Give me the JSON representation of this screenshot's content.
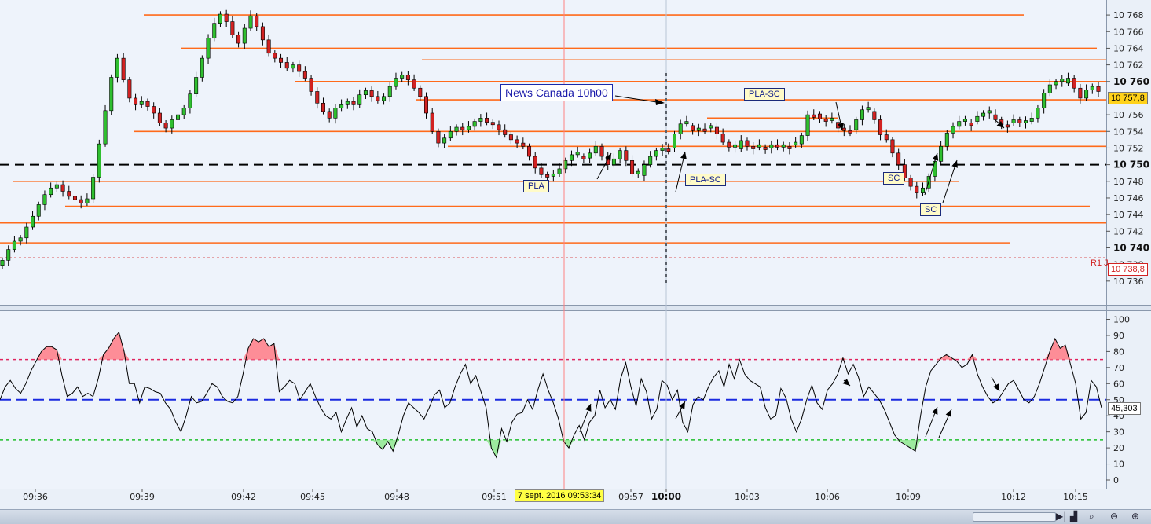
{
  "chart_data": [
    {
      "type": "candlestick",
      "title": "",
      "ylim": [
        10734.5,
        10769
      ],
      "yticks": [
        {
          "v": 10768,
          "t": "10 768",
          "bold": false
        },
        {
          "v": 10766,
          "t": "10 766",
          "bold": false
        },
        {
          "v": 10764,
          "t": "10 764",
          "bold": false
        },
        {
          "v": 10762,
          "t": "10 762",
          "bold": false
        },
        {
          "v": 10760,
          "t": "10 760",
          "bold": true
        },
        {
          "v": 10756,
          "t": "10 756",
          "bold": false
        },
        {
          "v": 10754,
          "t": "10 754",
          "bold": false
        },
        {
          "v": 10752,
          "t": "10 752",
          "bold": false
        },
        {
          "v": 10750,
          "t": "10 750",
          "bold": true
        },
        {
          "v": 10748,
          "t": "10 748",
          "bold": false
        },
        {
          "v": 10746,
          "t": "10 746",
          "bold": false
        },
        {
          "v": 10744,
          "t": "10 744",
          "bold": false
        },
        {
          "v": 10742,
          "t": "10 742",
          "bold": false
        },
        {
          "v": 10740,
          "t": "10 740",
          "bold": true
        },
        {
          "v": 10738,
          "t": "10 738",
          "bold": false
        },
        {
          "v": 10736,
          "t": "10 736",
          "bold": false
        }
      ],
      "xticks": [
        {
          "t": "09:36",
          "bold": false
        },
        {
          "t": "09:39",
          "bold": false
        },
        {
          "t": "09:42",
          "bold": false
        },
        {
          "t": "09:45",
          "bold": false
        },
        {
          "t": "09:48",
          "bold": false
        },
        {
          "t": "09:51",
          "bold": false
        },
        {
          "t": "09:57",
          "bold": false
        },
        {
          "t": "10:00",
          "bold": true
        },
        {
          "t": "10:03",
          "bold": false
        },
        {
          "t": "10:06",
          "bold": false
        },
        {
          "t": "10:09",
          "bold": false
        },
        {
          "t": "10:12",
          "bold": false
        },
        {
          "t": "10:15",
          "bold": false
        }
      ],
      "close_series": [
        10738.5,
        10739.8,
        10740.8,
        10741.2,
        10742.5,
        10743.8,
        10745.2,
        10746.4,
        10747.2,
        10747.6,
        10746.8,
        10746.2,
        10745.8,
        10745.4,
        10745.9,
        10748.5,
        10752.5,
        10756.5,
        10760.5,
        10762.8,
        10760.2,
        10758.0,
        10757.2,
        10757.6,
        10757.0,
        10756.2,
        10755.0,
        10754.4,
        10755.4,
        10756.0,
        10756.8,
        10758.5,
        10760.5,
        10762.8,
        10765.2,
        10767.0,
        10768.1,
        10767.2,
        10765.6,
        10764.6,
        10766.4,
        10767.9,
        10766.6,
        10765.0,
        10763.4,
        10762.8,
        10762.3,
        10761.6,
        10762.0,
        10761.2,
        10760.4,
        10758.8,
        10757.4,
        10756.4,
        10755.6,
        10756.8,
        10757.2,
        10757.6,
        10757.2,
        10758.4,
        10758.9,
        10758.2,
        10757.7,
        10758.2,
        10759.4,
        10760.4,
        10760.8,
        10760.2,
        10759.2,
        10758.2,
        10756.2,
        10754.0,
        10752.6,
        10753.2,
        10754.0,
        10754.5,
        10754.2,
        10754.6,
        10755.2,
        10755.6,
        10755.1,
        10754.8,
        10754.2,
        10753.6,
        10753.0,
        10752.6,
        10752.2,
        10751.0,
        10749.6,
        10748.8,
        10748.6,
        10748.9,
        10749.5,
        10750.5,
        10751.2,
        10751.0,
        10750.8,
        10751.4,
        10752.2,
        10751.0,
        10750.0,
        10750.7,
        10751.7,
        10750.5,
        10748.9,
        10748.7,
        10750.0,
        10751.0,
        10751.7,
        10751.9,
        10752.0,
        10753.7,
        10754.9,
        10754.7,
        10754.1,
        10754.3,
        10754.4,
        10754.5,
        10753.7,
        10752.7,
        10752.1,
        10751.9,
        10752.9,
        10752.2,
        10752.1,
        10752.1,
        10752.0,
        10752.4,
        10752.1,
        10752.2,
        10752.4,
        10752.5,
        10753.5,
        10756.0,
        10756.1,
        10755.5,
        10755.3,
        10755.1,
        10754.4,
        10754.1,
        10754.2,
        10755.4,
        10756.6,
        10756.4,
        10755.4,
        10753.6,
        10753.0,
        10751.4,
        10750.0,
        10748.4,
        10747.4,
        10746.6,
        10747.2,
        10748.6,
        10750.4,
        10752.2,
        10753.8,
        10754.6,
        10755.2,
        10755.0,
        10755.2,
        10755.8,
        10756.2,
        10756.0,
        10755.4,
        10754.8,
        10755.0,
        10755.4,
        10755.0,
        10755.2,
        10755.6,
        10756.8,
        10758.6,
        10759.6,
        10760.0,
        10759.8,
        10760.4,
        10759.2,
        10758.0,
        10759.0,
        10759.4,
        10758.8
      ],
      "horizontal_levels": [
        10768.0,
        10764.0,
        10762.6,
        10760.0,
        10757.8,
        10755.6,
        10754.0,
        10752.2,
        10748.0,
        10745.0,
        10743.0,
        10740.6
      ],
      "dashed_level": 10750,
      "r1_level": 10738.8,
      "r1_label": "R1 J",
      "r1_value_label": "10 738,8",
      "last_price_label": "10 757,8",
      "annotations": [
        {
          "t": "News Canada 10h00",
          "kind": "news"
        },
        {
          "t": "PLA-SC",
          "kind": "tag"
        },
        {
          "t": "PLA",
          "kind": "tag"
        },
        {
          "t": "PLA-SC",
          "kind": "tag"
        },
        {
          "t": "SC",
          "kind": "tag"
        },
        {
          "t": "SC",
          "kind": "tag"
        }
      ],
      "crosshair_date_label": "7 sept. 2016 09:53:34",
      "colors": {
        "up": "#2fbf2f",
        "down": "#d22222",
        "level": "#ff6a1a",
        "plot_bg": "#eef3fb"
      }
    },
    {
      "type": "line",
      "title": "",
      "ylim": [
        -3,
        104
      ],
      "yticks": [
        {
          "v": 100,
          "t": "100"
        },
        {
          "v": 90,
          "t": "90"
        },
        {
          "v": 80,
          "t": "80"
        },
        {
          "v": 70,
          "t": "70"
        },
        {
          "v": 60,
          "t": "60"
        },
        {
          "v": 50,
          "t": "50"
        },
        {
          "v": 40,
          "t": "40"
        },
        {
          "v": 30,
          "t": "30"
        },
        {
          "v": 20,
          "t": "20"
        },
        {
          "v": 10,
          "t": "10"
        },
        {
          "v": 0,
          "t": "0"
        }
      ],
      "levels": {
        "overbought": 75,
        "mid": 50,
        "oversold": 25
      },
      "last_value_label": "45,303",
      "series": [
        50,
        58,
        62,
        57,
        54,
        60,
        68,
        74,
        80,
        83,
        83,
        81,
        65,
        52,
        54,
        58,
        52,
        54,
        52,
        63,
        78,
        82,
        88,
        92,
        80,
        60,
        60,
        48,
        58,
        57,
        55,
        54,
        48,
        44,
        36,
        30,
        40,
        52,
        48,
        49,
        54,
        60,
        58,
        52,
        49,
        48,
        52,
        66,
        82,
        88,
        86,
        88,
        83,
        85,
        55,
        58,
        62,
        60,
        50,
        55,
        60,
        52,
        45,
        40,
        38,
        42,
        30,
        38,
        45,
        33,
        40,
        32,
        30,
        22,
        19,
        24,
        18,
        28,
        40,
        48,
        45,
        42,
        38,
        45,
        53,
        56,
        45,
        48,
        58,
        66,
        72,
        60,
        65,
        55,
        45,
        20,
        14,
        32,
        24,
        36,
        41,
        42,
        50,
        44,
        56,
        66,
        56,
        48,
        38,
        24,
        20,
        28,
        34,
        25,
        36,
        40,
        56,
        45,
        50,
        44,
        63,
        73,
        58,
        46,
        63,
        55,
        38,
        44,
        62,
        59,
        50,
        56,
        36,
        30,
        47,
        52,
        50,
        58,
        64,
        68,
        58,
        72,
        63,
        75,
        66,
        62,
        60,
        58,
        45,
        38,
        40,
        57,
        51,
        38,
        30,
        38,
        50,
        59,
        48,
        44,
        56,
        60,
        66,
        76,
        66,
        72,
        64,
        52,
        58,
        54,
        50,
        44,
        36,
        28,
        24,
        22,
        20,
        18,
        40,
        58,
        68,
        72,
        76,
        78,
        76,
        74,
        70,
        72,
        78,
        66,
        58,
        52,
        48,
        50,
        55,
        60,
        62,
        56,
        50,
        48,
        52,
        60,
        70,
        80,
        88,
        82,
        84,
        72,
        60,
        38,
        42,
        62,
        58,
        45
      ],
      "colors": {
        "line": "#000000",
        "overbought": "#ff7a85",
        "oversold": "#8ee88e"
      }
    }
  ]
}
